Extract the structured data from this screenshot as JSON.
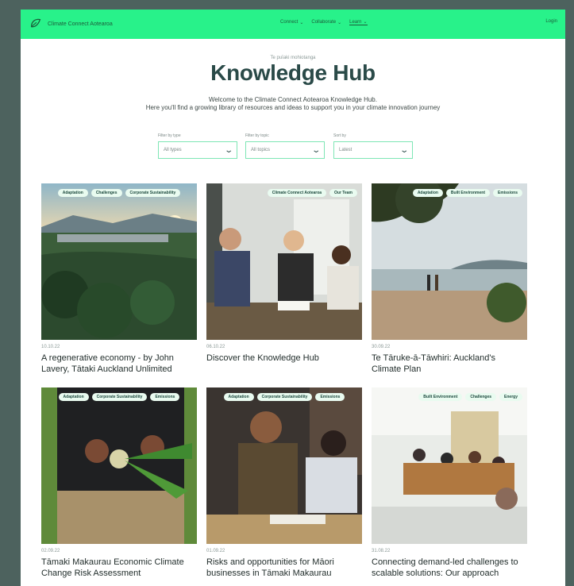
{
  "nav": {
    "brand": "Climate Connect Aotearoa",
    "items": [
      {
        "label": "Connect"
      },
      {
        "label": "Collaborate"
      },
      {
        "label": "Learn"
      }
    ],
    "login": "Login"
  },
  "hero": {
    "eyebrow": "Te puīaki mohiotanga",
    "title": "Knowledge Hub",
    "intro_line1": "Welcome to the Climate Connect Aotearoa Knowledge Hub.",
    "intro_line2": "Here you'll find a growing library of resources and ideas to support you in your climate innovation journey"
  },
  "filters": [
    {
      "label": "Filter by type",
      "value": "All types"
    },
    {
      "label": "Filter by topic",
      "value": "All topics"
    },
    {
      "label": "Sort by",
      "value": "Latest"
    }
  ],
  "cards": [
    {
      "tags": [
        "Adaptation",
        "Challenges",
        "Corporate Sustainability"
      ],
      "date": "10.10.22",
      "title": "A regenerative economy - by John Lavery, Tātaki Auckland Unlimited"
    },
    {
      "tags": [
        "Climate Connect Aotearoa",
        "Our Team"
      ],
      "date": "06.10.22",
      "title": "Discover the Knowledge Hub"
    },
    {
      "tags": [
        "Adaptation",
        "Built Environment",
        "Emissions"
      ],
      "date": "30.09.22",
      "title": "Te Tāruke-ā-Tāwhiri: Auckland's Climate Plan"
    },
    {
      "tags": [
        "Adaptation",
        "Corporate Sustainability",
        "Emissions"
      ],
      "date": "02.09.22",
      "title": "Tāmaki Makaurau Economic Climate Change Risk Assessment"
    },
    {
      "tags": [
        "Adaptation",
        "Corporate Sustainability",
        "Emissions"
      ],
      "date": "01.09.22",
      "title": "Risks and opportunities for Māori businesses in Tāmaki Makaurau"
    },
    {
      "tags": [
        "Built Environment",
        "Challenges",
        "Energy"
      ],
      "date": "31.08.22",
      "title": "Connecting demand-led challenges to scalable solutions: Our approach"
    }
  ]
}
